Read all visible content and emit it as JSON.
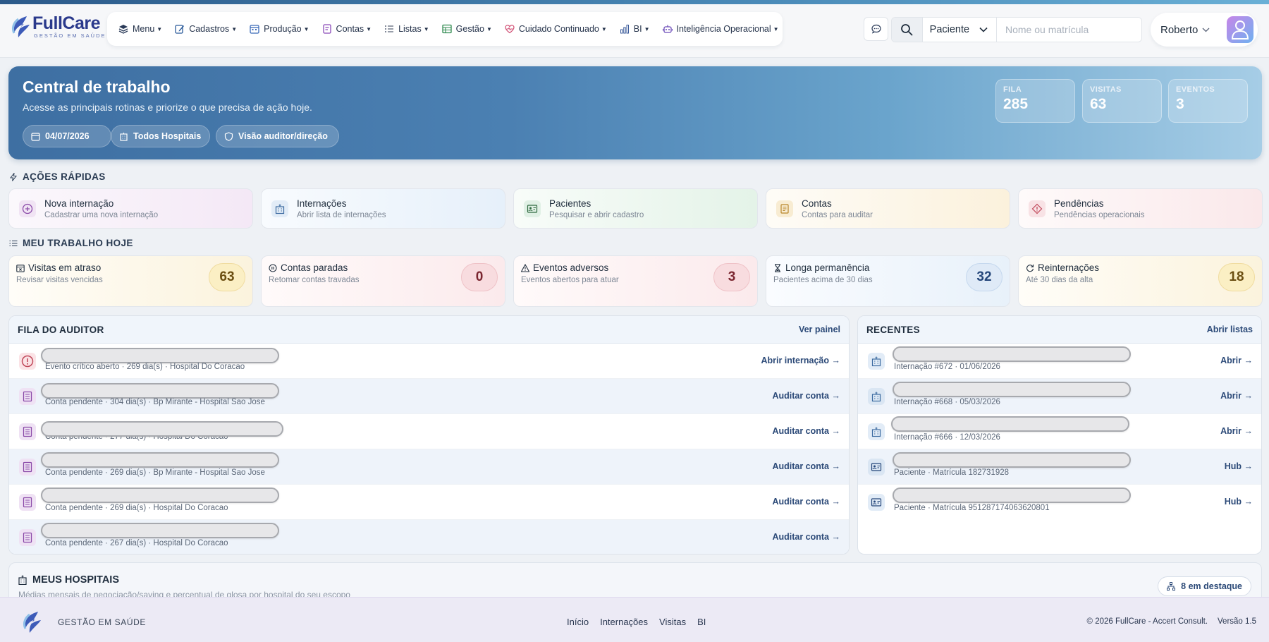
{
  "brand": {
    "name": "FullCare",
    "tagline": "GESTÃO EM SAÚDE"
  },
  "menu": [
    {
      "label": "Menu",
      "icon": "layers-icon"
    },
    {
      "label": "Cadastros",
      "icon": "edit-icon"
    },
    {
      "label": "Produção",
      "icon": "calendar-icon"
    },
    {
      "label": "Contas",
      "icon": "document-icon"
    },
    {
      "label": "Listas",
      "icon": "list-icon"
    },
    {
      "label": "Gestão",
      "icon": "table-icon"
    },
    {
      "label": "Cuidado Continuado",
      "icon": "heart-pulse-icon"
    },
    {
      "label": "BI",
      "icon": "bar-chart-icon"
    },
    {
      "label": "Inteligência Operacional",
      "icon": "robot-icon"
    }
  ],
  "search": {
    "type_selected": "Paciente",
    "placeholder": "Nome ou matrícula",
    "value": ""
  },
  "user": {
    "name": "Roberto"
  },
  "hero": {
    "title": "Central de trabalho",
    "subtitle": "Acesse as principais rotinas e priorize o que precisa de ação hoje.",
    "chips": [
      "04/07/2026",
      "Todos Hospitais",
      "Visão auditor/direção"
    ],
    "stats": [
      {
        "label": "FILA",
        "value": "285"
      },
      {
        "label": "VISITAS",
        "value": "63"
      },
      {
        "label": "EVENTOS",
        "value": "3"
      }
    ]
  },
  "quick_actions": {
    "title": "AÇÕES RÁPIDAS",
    "items": [
      {
        "title": "Nova internação",
        "desc": "Cadastrar uma nova internação",
        "icon": "plus-circle-icon",
        "color": "#8a4aa8"
      },
      {
        "title": "Internações",
        "desc": "Abrir lista de internações",
        "icon": "hospital-icon",
        "color": "#3b6aa0"
      },
      {
        "title": "Pacientes",
        "desc": "Pesquisar e abrir cadastro",
        "icon": "id-card-icon",
        "color": "#2f8a4f"
      },
      {
        "title": "Contas",
        "desc": "Contas para auditar",
        "icon": "receipt-icon",
        "color": "#b8862a"
      },
      {
        "title": "Pendências",
        "desc": "Pendências operacionais",
        "icon": "alert-diamond-icon",
        "color": "#c0485a"
      }
    ]
  },
  "work_today": {
    "title": "MEU TRABALHO HOJE",
    "items": [
      {
        "title": "Visitas em atraso",
        "desc": "Revisar visitas vencidas",
        "count": "63",
        "icon": "calendar-x-icon"
      },
      {
        "title": "Contas paradas",
        "desc": "Retomar contas travadas",
        "count": "0",
        "icon": "pause-icon"
      },
      {
        "title": "Eventos adversos",
        "desc": "Eventos abertos para atuar",
        "count": "3",
        "icon": "warning-icon"
      },
      {
        "title": "Longa permanência",
        "desc": "Pacientes acima de 30 dias",
        "count": "32",
        "icon": "hourglass-icon"
      },
      {
        "title": "Reinternações",
        "desc": "Até 30 dias da alta",
        "count": "18",
        "icon": "refresh-icon"
      }
    ]
  },
  "auditor_queue": {
    "title": "FILA DO AUDITOR",
    "link": "Ver painel",
    "rows": [
      {
        "sub": "Evento crítico aberto · 269 dia(s) · Hospital Do Coracao",
        "action": "Abrir internação",
        "type": "alert"
      },
      {
        "sub": "Conta pendente · 304 dia(s) · Bp Mirante - Hospital Sao Jose",
        "action": "Auditar conta",
        "type": "bill"
      },
      {
        "sub": "Conta pendente · 277 dia(s) · Hospital Do Coracao",
        "action": "Auditar conta",
        "type": "bill"
      },
      {
        "sub": "Conta pendente · 269 dia(s) · Bp Mirante - Hospital Sao Jose",
        "action": "Auditar conta",
        "type": "bill"
      },
      {
        "sub": "Conta pendente · 269 dia(s) · Hospital Do Coracao",
        "action": "Auditar conta",
        "type": "bill"
      },
      {
        "sub": "Conta pendente · 267 dia(s) · Hospital Do Coracao",
        "action": "Auditar conta",
        "type": "bill"
      }
    ]
  },
  "recents": {
    "title": "RECENTES",
    "link": "Abrir listas",
    "rows": [
      {
        "sub": "Internação #672 · 01/06/2026",
        "action": "Abrir",
        "type": "hospital"
      },
      {
        "sub": "Internação #668 · 05/03/2026",
        "action": "Abrir",
        "type": "hospital"
      },
      {
        "sub": "Internação #666 · 12/03/2026",
        "action": "Abrir",
        "type": "hospital"
      },
      {
        "sub": "Paciente · Matrícula 182731928",
        "action": "Hub",
        "type": "patient"
      },
      {
        "sub": "Paciente · Matrícula 951287174063620801",
        "action": "Hub",
        "type": "patient"
      }
    ]
  },
  "hospitals": {
    "title": "MEUS HOSPITAIS",
    "subtitle": "Médias mensais de negociação/saving e percentual de glosa por hospital do seu escopo",
    "badge": "8 em destaque"
  },
  "footer": {
    "brand": "GESTÃO EM SAÚDE",
    "links": [
      "Início",
      "Internações",
      "Visitas",
      "BI"
    ],
    "copyright": "© 2026 FullCare - Accert Consult.",
    "version": "Versão 1.5"
  }
}
